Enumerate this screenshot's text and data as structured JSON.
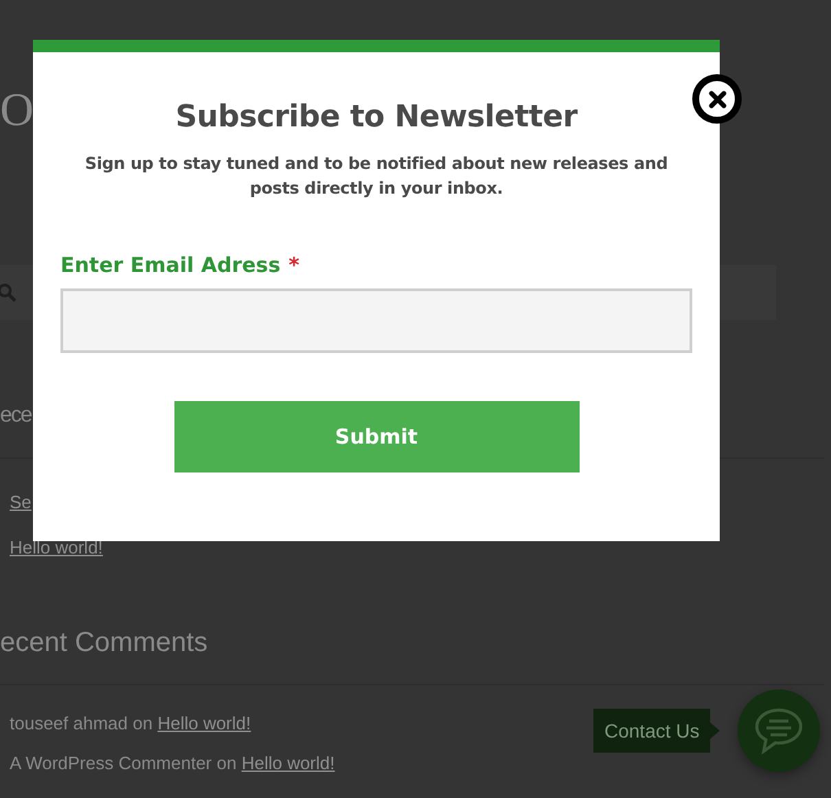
{
  "background_page": {
    "site_title": "O",
    "recent_posts": {
      "heading": "ece",
      "links": [
        "Se",
        "Hello world!"
      ]
    },
    "recent_comments": {
      "heading": "ecent Comments",
      "items": [
        {
          "author": "touseef ahmad",
          "connector": "on",
          "post": "Hello world!"
        },
        {
          "author": "A WordPress Commenter",
          "connector": "on",
          "post": "Hello world!"
        }
      ]
    }
  },
  "modal": {
    "title": "Subscribe to Newsletter",
    "description": "Sign up to stay tuned and to be notified about new releases and posts directly in your inbox.",
    "field": {
      "label": "Enter Email Adress",
      "required_mark": "*"
    },
    "submit": "Submit"
  },
  "contact_widget": {
    "label": "Contact Us"
  }
}
